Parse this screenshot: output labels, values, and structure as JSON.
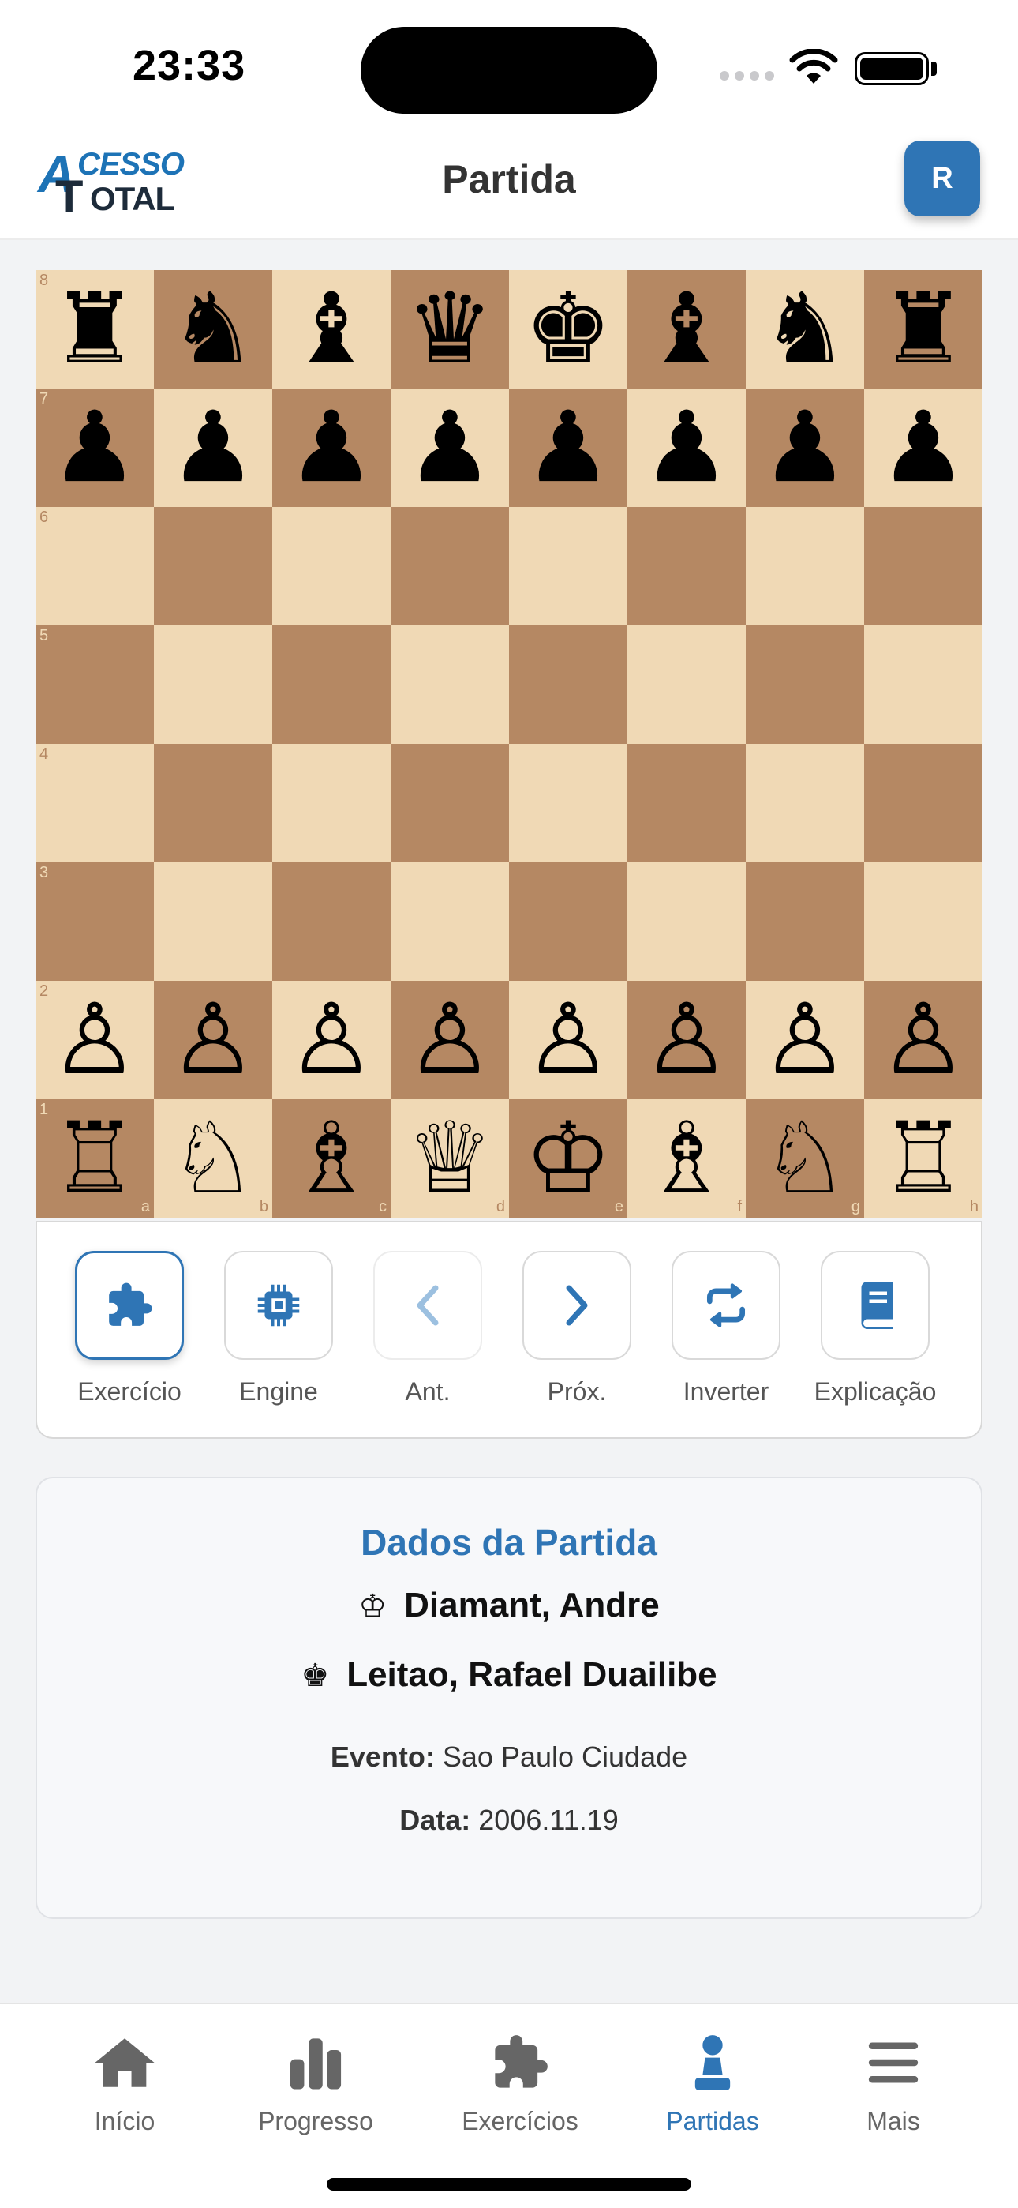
{
  "status_bar": {
    "time": "23:33"
  },
  "header": {
    "logo_top": "CESSO",
    "logo_bottom": "OTAL",
    "logo_letter_a": "A",
    "logo_letter_t": "T",
    "title": "Partida",
    "avatar_initial": "R"
  },
  "board": {
    "ranks": [
      "8",
      "7",
      "6",
      "5",
      "4",
      "3",
      "2",
      "1"
    ],
    "files": [
      "a",
      "b",
      "c",
      "d",
      "e",
      "f",
      "g",
      "h"
    ],
    "position": [
      [
        "♜",
        "♞",
        "♝",
        "♛",
        "♚",
        "♝",
        "♞",
        "♜"
      ],
      [
        "♟",
        "♟",
        "♟",
        "♟",
        "♟",
        "♟",
        "♟",
        "♟"
      ],
      [
        "",
        "",
        "",
        "",
        "",
        "",
        "",
        ""
      ],
      [
        "",
        "",
        "",
        "",
        "",
        "",
        "",
        ""
      ],
      [
        "",
        "",
        "",
        "",
        "",
        "",
        "",
        ""
      ],
      [
        "",
        "",
        "",
        "",
        "",
        "",
        "",
        ""
      ],
      [
        "♙",
        "♙",
        "♙",
        "♙",
        "♙",
        "♙",
        "♙",
        "♙"
      ],
      [
        "♖",
        "♘",
        "♗",
        "♕",
        "♔",
        "♗",
        "♘",
        "♖"
      ]
    ],
    "light_color": "#f0d9b5",
    "dark_color": "#b58863"
  },
  "controls": {
    "exercise": "Exercício",
    "engine": "Engine",
    "prev": "Ant.",
    "next": "Próx.",
    "flip": "Inverter",
    "explanation": "Explicação"
  },
  "game_info": {
    "title": "Dados da Partida",
    "white_symbol": "♔",
    "white_player": "Diamant, Andre",
    "black_symbol": "♚",
    "black_player": "Leitao, Rafael Duailibe",
    "event_label": "Evento:",
    "event": "Sao Paulo Ciudade",
    "date_label": "Data:",
    "date": "2006.11.19"
  },
  "tabbar": {
    "home": "Início",
    "progress": "Progresso",
    "exercises": "Exercícios",
    "games": "Partidas",
    "more": "Mais"
  },
  "colors": {
    "accent": "#2f75b5",
    "tab_inactive": "#666666"
  }
}
